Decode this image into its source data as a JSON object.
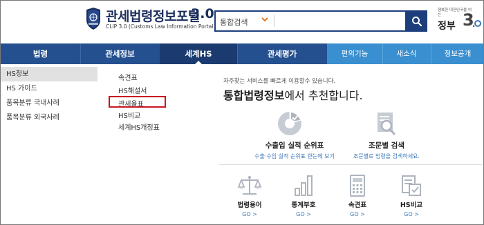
{
  "header": {
    "emblem_text": "관세청 KOREA CUSTOMS SERVICE",
    "title": "관세법령정보포털",
    "version": "3.0",
    "subtitle": "CLIP 3.0 (Customs Law Information Portal 3.0)",
    "search": {
      "category": "통합검색",
      "placeholder": ""
    },
    "gov_small": "행복한 대한민국을 여는",
    "gov_big": "정부",
    "gov_version": "3.0"
  },
  "nav": {
    "items": [
      {
        "label": "법령"
      },
      {
        "label": "관세정보"
      },
      {
        "label": "세계HS"
      },
      {
        "label": "관세평가"
      },
      {
        "label": "편의기능"
      },
      {
        "label": "새소식"
      },
      {
        "label": "정보공개"
      }
    ],
    "active_index": 2
  },
  "sidebar": {
    "items": [
      {
        "label": "HS정보",
        "active": true
      },
      {
        "label": "HS 가이드"
      },
      {
        "label": "품목분류 국내사례"
      },
      {
        "label": "품목분류 외국사례"
      }
    ]
  },
  "submenu": {
    "items": [
      {
        "label": "속견표"
      },
      {
        "label": "HS해설서"
      },
      {
        "label": "관세율표",
        "highlighted": true
      },
      {
        "label": "HS비교"
      },
      {
        "label": "세계HS개정표"
      }
    ]
  },
  "main": {
    "intro_small": "자주찾는 서비스를 빠르게 이용할수 있습니다.",
    "intro_big_prefix": "통합법령정보",
    "intro_big_suffix": "에서 추천합니다.",
    "features": [
      {
        "title": "수출입 실적 순위표",
        "desc": "수출·수입 실적 순위표 한눈에 보기",
        "icon": "pie-chart-icon"
      },
      {
        "title": "조문별 검색",
        "desc": "조문별로 법령을 검색하세요.",
        "icon": "document-search-icon"
      }
    ],
    "shortcuts": [
      {
        "label": "법령용어",
        "go": "GO >",
        "icon": "scale-icon"
      },
      {
        "label": "통계부호",
        "go": "GO >",
        "icon": "bar-chart-icon"
      },
      {
        "label": "속견표",
        "go": "GO >",
        "icon": "calculator-icon"
      },
      {
        "label": "HS비교",
        "go": "GO >",
        "icon": "compare-document-icon"
      }
    ]
  },
  "colors": {
    "brand_navy": "#1c2f5c",
    "nav_blue": "#25508f",
    "nav_active": "#1b3b70",
    "nav_util": "#3a8fd0",
    "highlight_red": "#c8171e",
    "link_blue": "#3a77b9"
  }
}
